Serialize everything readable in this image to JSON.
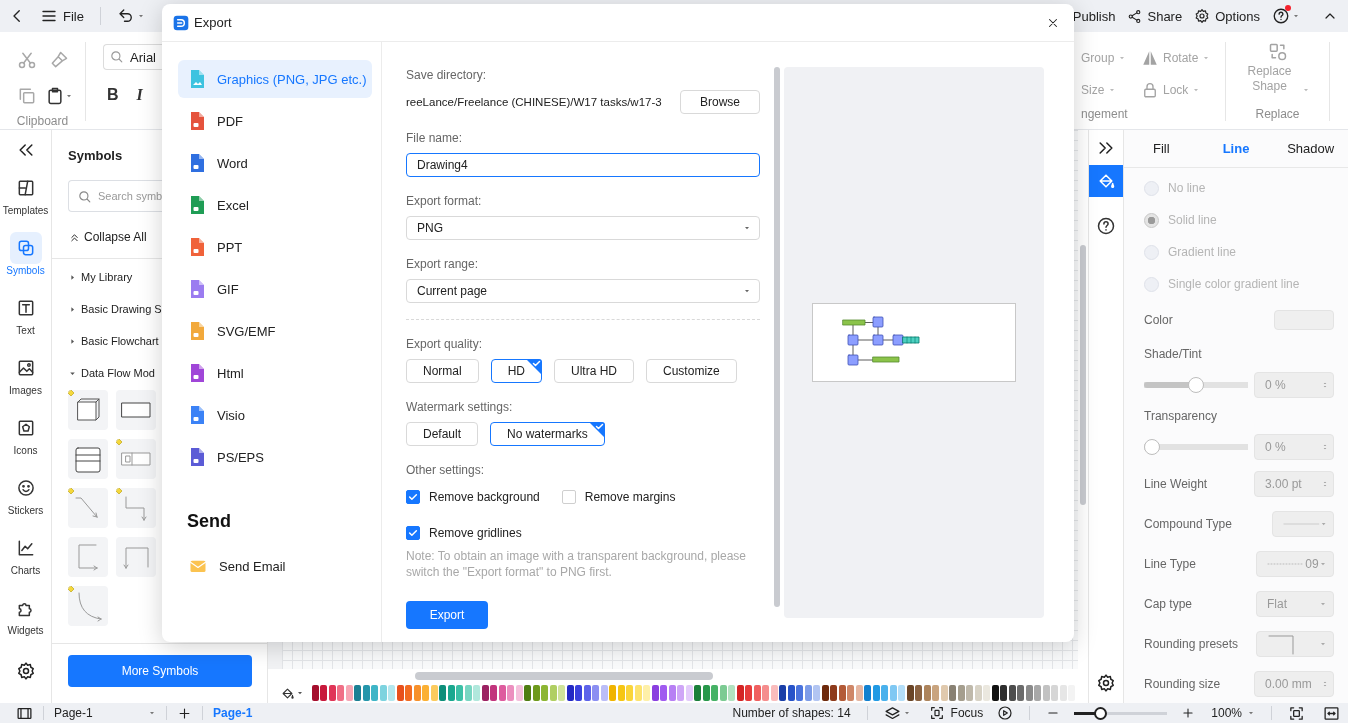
{
  "topbar": {
    "file_label": "File",
    "publish": "Publish",
    "share": "Share",
    "options": "Options",
    "help": {
      "notification": true
    }
  },
  "ribbon": {
    "clipboard_label": "Clipboard",
    "font_name": "Arial",
    "font_styles": [
      "B",
      "I"
    ],
    "arrange": [
      {
        "label": "Group"
      },
      {
        "label": "Rotate"
      },
      {
        "label": "Size"
      },
      {
        "label": "Lock"
      }
    ],
    "arrange_label": "ngement",
    "replace_button": "Replace Shape",
    "replace_label": "Replace"
  },
  "left_rail": {
    "items": [
      {
        "label": "Templates",
        "selected": false
      },
      {
        "label": "Symbols",
        "selected": true
      },
      {
        "label": "Text",
        "selected": false
      },
      {
        "label": "Images",
        "selected": false
      },
      {
        "label": "Icons",
        "selected": false
      },
      {
        "label": "Stickers",
        "selected": false
      },
      {
        "label": "Charts",
        "selected": false
      },
      {
        "label": "Widgets",
        "selected": false
      }
    ]
  },
  "symbols_panel": {
    "title": "Symbols",
    "search": {
      "placeholder": "Search symb"
    },
    "collapse_all": "Collapse All",
    "libraries": [
      {
        "label": "My Library",
        "expanded": false
      },
      {
        "label": "Basic Drawing S",
        "expanded": false
      },
      {
        "label": "Basic Flowchart",
        "expanded": false
      },
      {
        "label": "Data Flow Mod",
        "expanded": true
      }
    ],
    "more_button": "More Symbols"
  },
  "canvas": {
    "palette": [
      {
        "color": "#a50e2d"
      },
      {
        "color": "#c8193c"
      },
      {
        "color": "#e03557"
      },
      {
        "color": "#f06f86"
      },
      {
        "color": "#f7a6b4"
      },
      {
        "color": "#1b7f93"
      },
      {
        "color": "#2596ab"
      },
      {
        "color": "#3fb5c7"
      },
      {
        "color": "#7dd3df"
      },
      {
        "color": "#b4e7ee"
      },
      {
        "color": "#e8501c"
      },
      {
        "color": "#f26b22"
      },
      {
        "color": "#f7902b"
      },
      {
        "color": "#fbb034"
      },
      {
        "color": "#fccb5e"
      },
      {
        "color": "#0d8f7a"
      },
      {
        "color": "#1aa88f"
      },
      {
        "color": "#3cc0a6"
      },
      {
        "color": "#78d6c2"
      },
      {
        "color": "#b0e8dc"
      },
      {
        "color": "#9c2262"
      },
      {
        "color": "#c2347d"
      },
      {
        "color": "#de5c9e"
      },
      {
        "color": "#ec8fbf"
      },
      {
        "color": "#f5c0dc"
      },
      {
        "color": "#4f7d12"
      },
      {
        "color": "#6e9a1c"
      },
      {
        "color": "#8db633"
      },
      {
        "color": "#b0cf62"
      },
      {
        "color": "#cfe39a"
      },
      {
        "color": "#2329c4"
      },
      {
        "color": "#3940dd"
      },
      {
        "color": "#5d63ea"
      },
      {
        "color": "#8b8ff2"
      },
      {
        "color": "#bbbdf7"
      },
      {
        "color": "#f0b400"
      },
      {
        "color": "#f6c613"
      },
      {
        "color": "#fad53a"
      },
      {
        "color": "#fde36e"
      },
      {
        "color": "#fef0a8"
      },
      {
        "color": "#8a3fe0"
      },
      {
        "color": "#a05bf0"
      },
      {
        "color": "#b77ff4"
      },
      {
        "color": "#cfa6f7"
      },
      {
        "color": "#e3cbfb"
      },
      {
        "color": "#1a7f3a"
      },
      {
        "color": "#27984a"
      },
      {
        "color": "#46b266"
      },
      {
        "color": "#7ccb93"
      },
      {
        "color": "#b2e2c0"
      },
      {
        "color": "#d42424"
      },
      {
        "color": "#e63b3b"
      },
      {
        "color": "#f06060"
      },
      {
        "color": "#f58d8d"
      },
      {
        "color": "#fabcbc"
      },
      {
        "color": "#1a3fa8"
      },
      {
        "color": "#2753c9"
      },
      {
        "color": "#4a73dd"
      },
      {
        "color": "#7d9ce8"
      },
      {
        "color": "#b2c5f2"
      },
      {
        "color": "#6e2a0c"
      },
      {
        "color": "#8e3b1c"
      },
      {
        "color": "#b35a37"
      },
      {
        "color": "#cf8768"
      },
      {
        "color": "#e6b6a1"
      },
      {
        "color": "#1280cf"
      },
      {
        "color": "#219ae4"
      },
      {
        "color": "#4ab1ec"
      },
      {
        "color": "#7fc8f3"
      },
      {
        "color": "#b4def8"
      },
      {
        "color": "#6a4527"
      },
      {
        "color": "#8a6241"
      },
      {
        "color": "#ad845c"
      },
      {
        "color": "#c9a47f"
      },
      {
        "color": "#e0c9ad"
      },
      {
        "color": "#898173"
      },
      {
        "color": "#a59e8e"
      },
      {
        "color": "#bfb9ab"
      },
      {
        "color": "#d8d3c6"
      },
      {
        "color": "#ebe8df"
      },
      {
        "color": "#111111"
      },
      {
        "color": "#2e2e2e"
      },
      {
        "color": "#4d4d4d"
      },
      {
        "color": "#6b6b6b"
      },
      {
        "color": "#8a8a8a"
      },
      {
        "color": "#a8a8a8"
      },
      {
        "color": "#c2c2c2"
      },
      {
        "color": "#d6d6d6"
      },
      {
        "color": "#e6e6e6"
      },
      {
        "color": "#f3f3f3"
      }
    ]
  },
  "tool_rail": {
    "tools": [
      {
        "selected": true
      },
      {
        "selected": false
      }
    ]
  },
  "properties": {
    "tabs": [
      {
        "label": "Fill",
        "selected": false
      },
      {
        "label": "Line",
        "selected": true
      },
      {
        "label": "Shadow",
        "selected": false
      }
    ],
    "line_options": [
      {
        "label": "No line",
        "selected": false,
        "disabled": true
      },
      {
        "label": "Solid line",
        "selected": true,
        "disabled": true
      },
      {
        "label": "Gradient line",
        "selected": false,
        "disabled": true
      },
      {
        "label": "Single color gradient line",
        "selected": false,
        "disabled": true
      }
    ],
    "rows": [
      {
        "kind": "color",
        "label": "Color"
      },
      {
        "kind": "slider",
        "label": "Shade/Tint",
        "level": 0.5,
        "value": "0 %"
      },
      {
        "kind": "slider",
        "label": "Transparency",
        "level": 0,
        "value": "0 %"
      },
      {
        "kind": "spinner",
        "label": "Line Weight",
        "value": "3.00 pt"
      },
      {
        "kind": "line-style",
        "label": "Compound Type"
      },
      {
        "kind": "dash-style",
        "label": "Line Type",
        "value": "09"
      },
      {
        "kind": "select",
        "label": "Cap type",
        "value": "Flat"
      },
      {
        "kind": "corner-style",
        "label": "Rounding presets"
      },
      {
        "kind": "spinner",
        "label": "Rounding size",
        "value": "0.00 mm"
      }
    ]
  },
  "status_bar": {
    "page_select": "Page-1",
    "page_tabs": [
      {
        "label": "Page-1",
        "selected": true
      }
    ],
    "shape_count": "Number of shapes: 14",
    "focus": "Focus",
    "zoom": {
      "level": 0.25,
      "value": "100%"
    }
  },
  "export_dialog": {
    "title": "Export",
    "formats": [
      {
        "label": "Graphics (PNG, JPG etc.)",
        "selected": true,
        "color": "#3ec3e0"
      },
      {
        "label": "PDF",
        "selected": false,
        "color": "#e5533d"
      },
      {
        "label": "Word",
        "selected": false,
        "color": "#2f6fe0"
      },
      {
        "label": "Excel",
        "selected": false,
        "color": "#1f9d55"
      },
      {
        "label": "PPT",
        "selected": false,
        "color": "#f0623a"
      },
      {
        "label": "GIF",
        "selected": false,
        "color": "#9b7cf0"
      },
      {
        "label": "SVG/EMF",
        "selected": false,
        "color": "#f2a93b"
      },
      {
        "label": "Html",
        "selected": false,
        "color": "#a046d8"
      },
      {
        "label": "Visio",
        "selected": false,
        "color": "#3b82f6"
      },
      {
        "label": "PS/EPS",
        "selected": false,
        "color": "#5b5bd6"
      }
    ],
    "send_heading": "Send",
    "send_items": [
      {
        "label": "Send Email"
      }
    ],
    "save_directory": {
      "label": "Save directory:",
      "path": "reeLance/Freelance (CHINESE)/W17 tasks/w17-3",
      "button": "Browse"
    },
    "file_name": {
      "label": "File name:",
      "value": "Drawing4"
    },
    "export_format": {
      "label": "Export format:",
      "value": "PNG"
    },
    "export_range": {
      "label": "Export range:",
      "value": "Current page"
    },
    "quality": {
      "label": "Export quality:",
      "options": [
        {
          "label": "Normal",
          "selected": false
        },
        {
          "label": "HD",
          "selected": true
        },
        {
          "label": "Ultra HD",
          "selected": false
        },
        {
          "label": "Customize",
          "selected": false
        }
      ]
    },
    "watermark": {
      "label": "Watermark settings:",
      "options": [
        {
          "label": "Default",
          "selected": false
        },
        {
          "label": "No watermarks",
          "selected": true
        }
      ]
    },
    "other": {
      "label": "Other settings:",
      "options": [
        {
          "label": "Remove background",
          "checked": true
        },
        {
          "label": "Remove margins",
          "checked": false
        },
        {
          "label": "Remove gridlines",
          "checked": true
        }
      ]
    },
    "note": "Note: To obtain an image with a transparent background, please switch the \"Export format\" to PNG first.",
    "export_button": "Export"
  }
}
